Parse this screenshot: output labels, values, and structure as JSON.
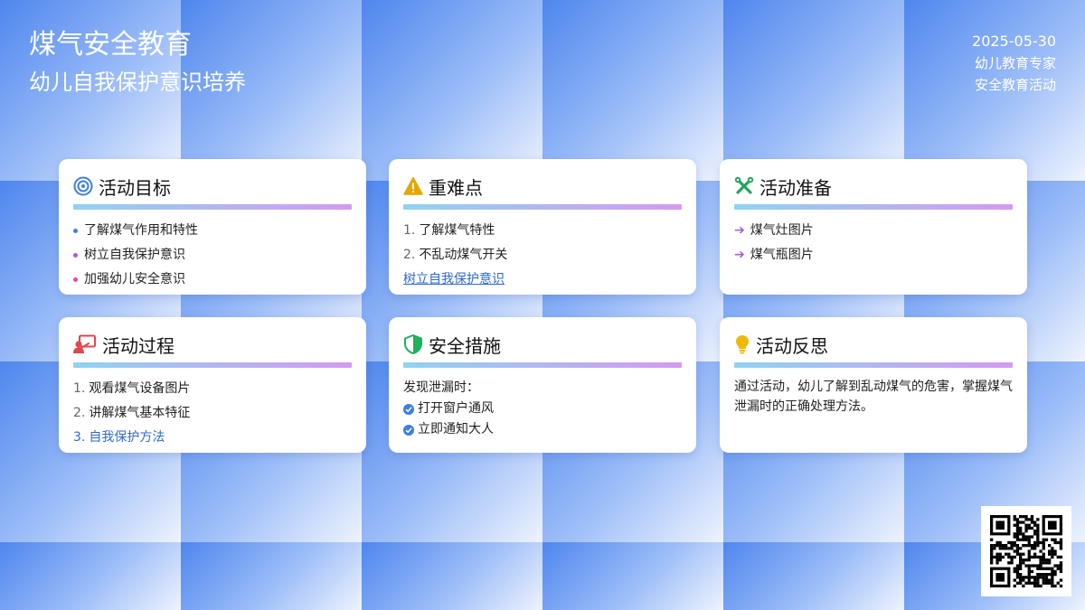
{
  "header": {
    "title": "煤气安全教育",
    "subtitle": "幼儿自我保护意识培养",
    "date": "2025-05-30",
    "author": "幼儿教育专家",
    "category": "安全教育活动"
  },
  "cards": {
    "goals": {
      "title": "活动目标",
      "icon": "target-icon",
      "items": [
        "了解煤气作用和特性",
        "树立自我保护意识",
        "加强幼儿安全意识"
      ],
      "bullet_colors": [
        "#3b82f6",
        "#a855f7",
        "#ec4899"
      ]
    },
    "key_points": {
      "title": "重难点",
      "icon": "warning-icon",
      "items": [
        {
          "num": "1.",
          "text": "了解煤气特性"
        },
        {
          "num": "2.",
          "text": "不乱动煤气开关"
        }
      ],
      "link": "树立自我保护意识"
    },
    "preparation": {
      "title": "活动准备",
      "icon": "tools-icon",
      "items": [
        "煤气灶图片",
        "煤气瓶图片"
      ]
    },
    "process": {
      "title": "活动过程",
      "icon": "teacher-icon",
      "items": [
        {
          "num": "1.",
          "text": "观看煤气设备图片"
        },
        {
          "num": "2.",
          "text": "讲解煤气基本特征"
        },
        {
          "num": "3.",
          "text": "自我保护方法"
        }
      ]
    },
    "safety": {
      "title": "安全措施",
      "icon": "shield-icon",
      "lead": "发现泄漏时：",
      "items": [
        "打开窗户通风",
        "立即通知大人"
      ]
    },
    "reflection": {
      "title": "活动反思",
      "icon": "lightbulb-icon",
      "text": "通过活动，幼儿了解到乱动煤气的危害，掌握煤气泄漏时的正确处理方法。"
    }
  },
  "qr": {
    "icon": "qr-code-icon"
  },
  "colors": {
    "accent_blue": "#2f6ad0",
    "warning_yellow": "#e6a700",
    "tools_green": "#22a559",
    "teacher_red": "#e0474c",
    "shield_green": "#21b15a",
    "bulb_yellow": "#f2b807"
  }
}
